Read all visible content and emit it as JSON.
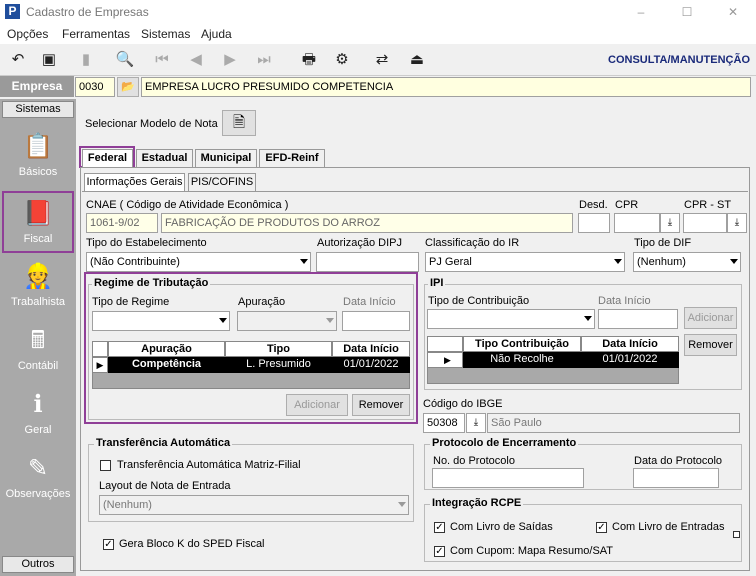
{
  "window": {
    "title": "Cadastro de Empresas",
    "app_icon": "P",
    "minimize": "–",
    "maximize": "☐",
    "close": "✕"
  },
  "menu": [
    "Opções",
    "Ferramentas",
    "Sistemas",
    "Ajuda"
  ],
  "toolbar": {
    "mode": "CONSULTA/MANUTENÇÃO",
    "icons": [
      "undo-icon",
      "save-icon",
      "new-doc-icon",
      "preview-icon",
      "first-icon",
      "prev-icon",
      "next-icon",
      "last-icon",
      "print-icon",
      "tools-icon",
      "transfer-icon",
      "exit-icon"
    ]
  },
  "empresa": {
    "label": "Empresa",
    "code": "0030",
    "name": "EMPRESA LUCRO PRESUMIDO COMPETENCIA"
  },
  "sidebar": {
    "header": "Sistemas",
    "footer": "Outros",
    "items": [
      "Básicos",
      "Fiscal",
      "Trabalhista",
      "Contábil",
      "Geral",
      "Observações"
    ]
  },
  "modelo": {
    "label": "Selecionar Modelo de Nota"
  },
  "tabs": [
    "Federal",
    "Estadual",
    "Municipal",
    "EFD-Reinf"
  ],
  "subtabs": [
    "Informações Gerais",
    "PIS/COFINS"
  ],
  "cnae": {
    "label": "CNAE ( Código de  Atividade Econômica )",
    "code": "1061-9/02",
    "desc": "FABRICAÇÃO DE PRODUTOS DO ARROZ"
  },
  "desd": {
    "label": "Desd."
  },
  "cpr": {
    "label": "CPR"
  },
  "cpr_st": {
    "label": "CPR - ST"
  },
  "tipo_estab": {
    "label": "Tipo do Estabelecimento",
    "value": "(Não Contribuinte)"
  },
  "aut_dipj": {
    "label": "Autorização DIPJ"
  },
  "class_ir": {
    "label": "Classificação do IR",
    "value": "PJ Geral"
  },
  "tipo_dif": {
    "label": "Tipo de DIF",
    "value": "(Nenhum)"
  },
  "regime": {
    "title": "Regime de Tributação",
    "tipo_label": "Tipo de Regime",
    "apuracao_label": "Apuração",
    "data_label": "Data Início",
    "columns": [
      "Apuração",
      "Tipo",
      "Data Início"
    ],
    "row": [
      "Competência",
      "L. Presumido",
      "01/01/2022"
    ],
    "add": "Adicionar",
    "remove": "Remover"
  },
  "ipi": {
    "title": "IPI",
    "tipo_label": "Tipo de Contribuição",
    "data_label": "Data Início",
    "columns": [
      "Tipo Contribuição",
      "Data Início"
    ],
    "row": [
      "Não Recolhe",
      "01/01/2022"
    ],
    "add": "Adicionar",
    "remove": "Remover"
  },
  "ibge": {
    "label": "Código do IBGE",
    "code": "50308",
    "city": "São Paulo"
  },
  "transf": {
    "title": "Transferência Automática",
    "check_label": "Transferência Automática Matriz-Filial",
    "layout_label": "Layout de Nota de Entrada",
    "layout_value": "(Nenhum)"
  },
  "bloco_k": {
    "label": "Gera Bloco K do SPED Fiscal",
    "checked": true
  },
  "protocolo": {
    "title": "Protocolo de Encerramento",
    "no_label": "No. do Protocolo",
    "data_label": "Data do Protocolo"
  },
  "rcpe": {
    "title": "Integração RCPE",
    "saidas": "Com Livro de Saídas",
    "entradas": "Com Livro de Entradas",
    "cupom": "Com Cupom: Mapa Resumo/SAT"
  },
  "colors": {
    "highlight": "#8f3f97",
    "sidebar": "#a9a9a9",
    "mode_text": "#1a2a7a"
  }
}
